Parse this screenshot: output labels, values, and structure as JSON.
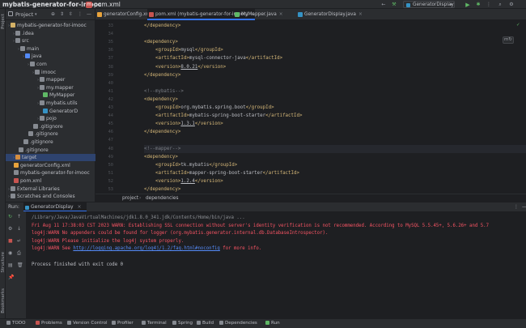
{
  "titlebar": {
    "project_name": "mybatis-generator-for-imooc",
    "file_name": "pom.xml",
    "run_config": "GeneratorDisplay"
  },
  "side_labels": {
    "project": "Project",
    "structure": "Structure",
    "bookmarks": "Bookmarks"
  },
  "project_panel": {
    "title": "Project",
    "tree": [
      {
        "label": "mybatis-generator-for-imooc",
        "depth": 0,
        "icon": "folder-icon",
        "color": "#d3b166"
      },
      {
        "label": ".idea",
        "depth": 1,
        "icon": "folder-icon",
        "color": "#868a91"
      },
      {
        "label": "src",
        "depth": 1,
        "icon": "folder-icon",
        "color": "#868a91"
      },
      {
        "label": "main",
        "depth": 2,
        "icon": "folder-icon",
        "color": "#868a91"
      },
      {
        "label": "java",
        "depth": 3,
        "icon": "folder-icon",
        "color": "#548af7"
      },
      {
        "label": "com",
        "depth": 4,
        "icon": "package-icon",
        "color": "#868a91"
      },
      {
        "label": "imooc",
        "depth": 5,
        "icon": "package-icon",
        "color": "#868a91"
      },
      {
        "label": "mapper",
        "depth": 6,
        "icon": "package-icon",
        "color": "#868a91"
      },
      {
        "label": "my.mapper",
        "depth": 6,
        "icon": "package-icon",
        "color": "#868a91"
      },
      {
        "label": "MyMapper",
        "depth": 7,
        "icon": "interface-icon",
        "color": "#5fb865"
      },
      {
        "label": "mybatis.utils",
        "depth": 6,
        "icon": "package-icon",
        "color": "#868a91"
      },
      {
        "label": "GeneratorD",
        "depth": 7,
        "icon": "class-icon",
        "color": "#3592c4"
      },
      {
        "label": "pojo",
        "depth": 6,
        "icon": "package-icon",
        "color": "#868a91"
      },
      {
        "label": ".gitignore",
        "depth": 5,
        "icon": "file-icon",
        "color": "#868a91"
      },
      {
        "label": ".gitignore",
        "depth": 4,
        "icon": "file-icon",
        "color": "#868a91"
      },
      {
        "label": ".gitignore",
        "depth": 3,
        "icon": "file-icon",
        "color": "#868a91"
      },
      {
        "label": ".gitignore",
        "depth": 2,
        "icon": "file-icon",
        "color": "#868a91"
      },
      {
        "label": "target",
        "depth": 1,
        "icon": "folder-icon",
        "color": "#d38d40",
        "selected": true
      },
      {
        "label": "generatorConfig.xml",
        "depth": 1,
        "icon": "xml-icon",
        "color": "#e8a33c"
      },
      {
        "label": "mybatis-generator-for-imooc",
        "depth": 1,
        "icon": "file-icon",
        "color": "#868a91"
      },
      {
        "label": "pom.xml",
        "depth": 1,
        "icon": "maven-icon",
        "color": "#c75450"
      },
      {
        "label": "External Libraries",
        "depth": 0,
        "icon": "library-icon",
        "color": "#868a91"
      },
      {
        "label": "Scratches and Consoles",
        "depth": 0,
        "icon": "scratch-icon",
        "color": "#868a91"
      }
    ]
  },
  "tabs": [
    {
      "label": "generatorConfig.xml",
      "color": "#e8a33c"
    },
    {
      "label": "pom.xml (mybatis-generator-for-imooc)",
      "color": "#c75450",
      "active": true
    },
    {
      "label": "MyMapper.java",
      "color": "#5fb865"
    },
    {
      "label": "GeneratorDisplay.java",
      "color": "#3592c4"
    }
  ],
  "editor": {
    "lines": [
      {
        "n": "33",
        "indent": 0,
        "parts": [
          [
            "tg",
            "</dependency>"
          ]
        ]
      },
      {
        "n": "34",
        "indent": 0,
        "parts": []
      },
      {
        "n": "35",
        "indent": 0,
        "parts": [
          [
            "tg",
            "<dependency>"
          ]
        ]
      },
      {
        "n": "36",
        "indent": 1,
        "parts": [
          [
            "tg",
            "<groupId>"
          ],
          [
            "tx",
            "mysql"
          ],
          [
            "tg",
            "</groupId>"
          ]
        ]
      },
      {
        "n": "37",
        "indent": 1,
        "parts": [
          [
            "tg",
            "<artifactId>"
          ],
          [
            "tx",
            "mysql-connector-java"
          ],
          [
            "tg",
            "</artifactId>"
          ]
        ]
      },
      {
        "n": "38",
        "indent": 1,
        "parts": [
          [
            "tg",
            "<version>"
          ],
          [
            "txu",
            "8.0.21"
          ],
          [
            "tg",
            "</version>"
          ]
        ]
      },
      {
        "n": "39",
        "indent": 0,
        "parts": [
          [
            "tg",
            "</dependency>"
          ]
        ]
      },
      {
        "n": "40",
        "indent": 0,
        "parts": []
      },
      {
        "n": "41",
        "indent": 0,
        "parts": [
          [
            "cm",
            "<!--mybatis-->"
          ]
        ]
      },
      {
        "n": "42",
        "indent": 0,
        "parts": [
          [
            "tg",
            "<dependency>"
          ]
        ]
      },
      {
        "n": "43",
        "indent": 1,
        "parts": [
          [
            "tg",
            "<groupId>"
          ],
          [
            "tx",
            "org.mybatis.spring.boot"
          ],
          [
            "tg",
            "</groupId>"
          ]
        ]
      },
      {
        "n": "44",
        "indent": 1,
        "parts": [
          [
            "tg",
            "<artifactId>"
          ],
          [
            "tx",
            "mybatis-spring-boot-starter"
          ],
          [
            "tg",
            "</artifactId>"
          ]
        ]
      },
      {
        "n": "45",
        "indent": 1,
        "parts": [
          [
            "tg",
            "<version>"
          ],
          [
            "txu",
            "1.3.1"
          ],
          [
            "tg",
            "</version>"
          ]
        ]
      },
      {
        "n": "46",
        "indent": 0,
        "parts": [
          [
            "tg",
            "</dependency>"
          ]
        ]
      },
      {
        "n": "47",
        "indent": 0,
        "parts": []
      },
      {
        "n": "48",
        "indent": 0,
        "parts": [
          [
            "cm",
            "<!--mapper-->"
          ]
        ],
        "hl": true
      },
      {
        "n": "49",
        "indent": 0,
        "parts": [
          [
            "tg",
            "<dependency>"
          ]
        ]
      },
      {
        "n": "50",
        "indent": 1,
        "parts": [
          [
            "tg",
            "<groupId>"
          ],
          [
            "tx",
            "tk.mybatis"
          ],
          [
            "tg",
            "</groupId>"
          ]
        ]
      },
      {
        "n": "51",
        "indent": 1,
        "parts": [
          [
            "tg",
            "<artifactId>"
          ],
          [
            "tx",
            "mapper-spring-boot-starter"
          ],
          [
            "tg",
            "</artifactId>"
          ]
        ]
      },
      {
        "n": "52",
        "indent": 1,
        "parts": [
          [
            "tg",
            "<version>"
          ],
          [
            "txu",
            "1.2.4"
          ],
          [
            "tg",
            "</version>"
          ]
        ]
      },
      {
        "n": "53",
        "indent": 0,
        "parts": [
          [
            "tg",
            "</dependency>"
          ]
        ]
      }
    ],
    "breadcrumbs": [
      "project",
      "dependencies"
    ]
  },
  "run_panel": {
    "title": "Run:",
    "config_tab": "GeneratorDisplay",
    "output": [
      {
        "text": "/Library/Java/JavaVirtualMachines/jdk1.8.0_341.jdk/Contents/Home/bin/java ...",
        "kind": "gray"
      },
      {
        "text": "Fri Aug 11 17:38:03 CST 2023 WARN: Establishing SSL connection without server's identity verification is not recommended. According to MySQL 5.5.45+, 5.6.26+ and 5.7",
        "kind": "err"
      },
      {
        "text": "log4j:WARN No appenders could be found for logger (org.mybatis.generator.internal.db.DatabaseIntrospector).",
        "kind": "err"
      },
      {
        "text": "log4j:WARN Please initialize the log4j system properly.",
        "kind": "err"
      },
      {
        "text": "log4j:WARN See ",
        "kind": "err",
        "link": "http://logging.apache.org/log4j/1.2/faq.html#noconfig",
        "after": " for more info."
      },
      {
        "text": "",
        "kind": "plain"
      },
      {
        "text": "Process finished with exit code 0",
        "kind": "plain"
      }
    ]
  },
  "statusbar": {
    "items": [
      "TODO",
      "Problems",
      "Version Control",
      "Profiler",
      "Terminal",
      "Spring",
      "Build",
      "Dependencies",
      "Run"
    ]
  },
  "colors": {
    "accent": "#3574f0",
    "run_green": "#5fb865",
    "error_red": "#f75464"
  }
}
